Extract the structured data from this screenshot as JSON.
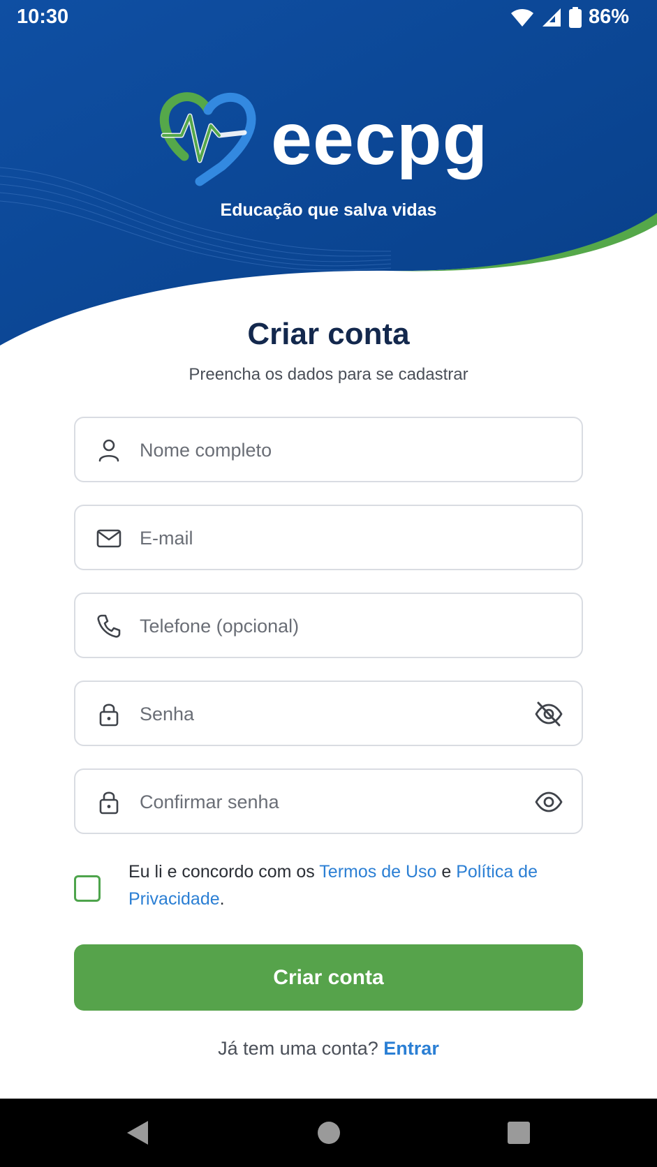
{
  "status_bar": {
    "time": "10:30",
    "battery": "86%"
  },
  "brand": {
    "name": "eecpg",
    "tagline": "Educação que salva vidas"
  },
  "form": {
    "title": "Criar conta",
    "subtitle": "Preencha os dados para se cadastrar",
    "fields": {
      "name": {
        "placeholder": "Nome completo",
        "value": ""
      },
      "email": {
        "placeholder": "E-mail",
        "value": ""
      },
      "phone": {
        "placeholder": "Telefone (opcional)",
        "value": ""
      },
      "password": {
        "placeholder": "Senha",
        "value": ""
      },
      "confirm_password": {
        "placeholder": "Confirmar senha",
        "value": ""
      }
    },
    "terms": {
      "prefix": "Eu li e concordo com os",
      "terms_link": "Termos de Uso",
      "joiner": "e",
      "privacy_link": "Política de Privacidade",
      "suffix": ".",
      "checked": false
    },
    "submit_label": "Criar conta",
    "login_prompt": "Já tem uma conta?",
    "login_link": "Entrar"
  },
  "colors": {
    "brand_blue": "#0d4a98",
    "brand_green": "#56a34b",
    "link_blue": "#2b7fd4",
    "title_navy": "#13284d"
  },
  "icons": {
    "status": [
      "wifi-icon",
      "cell-signal-icon",
      "battery-icon"
    ],
    "fields": [
      "person-icon",
      "mail-icon",
      "phone-icon",
      "lock-icon",
      "lock-icon"
    ],
    "password_toggles": [
      "eye-off-icon",
      "eye-icon"
    ],
    "navigation": [
      "back-icon",
      "home-icon",
      "recents-icon"
    ]
  }
}
